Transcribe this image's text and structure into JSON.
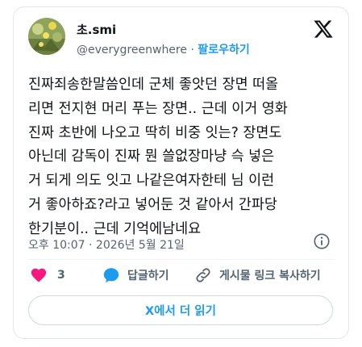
{
  "author": {
    "display_name": "초.smi",
    "handle": "@everygreenwhere",
    "separator": "·",
    "follow_label": "팔로우하기"
  },
  "tweet": {
    "lines": [
      "진짜죄송한말씀인데 군체 좋앗던 장면 떠올",
      "리면 전지현 머리 푸는 장면.. 근데 이거 영화",
      "진짜 초반에 나오고 딱히 비중 잇는? 장면도",
      "아닌데 감독이 진짜 뭔 쓸없장마냥 슥 넣은",
      "거 되게 의도 잇고 나같은여자한테 님 이런",
      "거 좋아하죠?라고 넣어둔 것 같아서 간파당",
      "한기분이.. 근데 기억에남네요"
    ],
    "meta": "오후 10:07 · 2026년 5월 21일"
  },
  "actions": {
    "like_count": "3",
    "reply_label": "답글하기",
    "share_label": "게시물 링크 복사하기"
  },
  "read_more_label": "X에서 더 읽기",
  "colors": {
    "accent": "#1d9bf0",
    "like": "#f91880",
    "secondary_text": "#536471",
    "border": "#e3e6e8"
  },
  "icons": [
    "avatar-image",
    "x-logo-icon",
    "info-icon",
    "heart-icon",
    "reply-bubble-icon",
    "link-icon"
  ]
}
